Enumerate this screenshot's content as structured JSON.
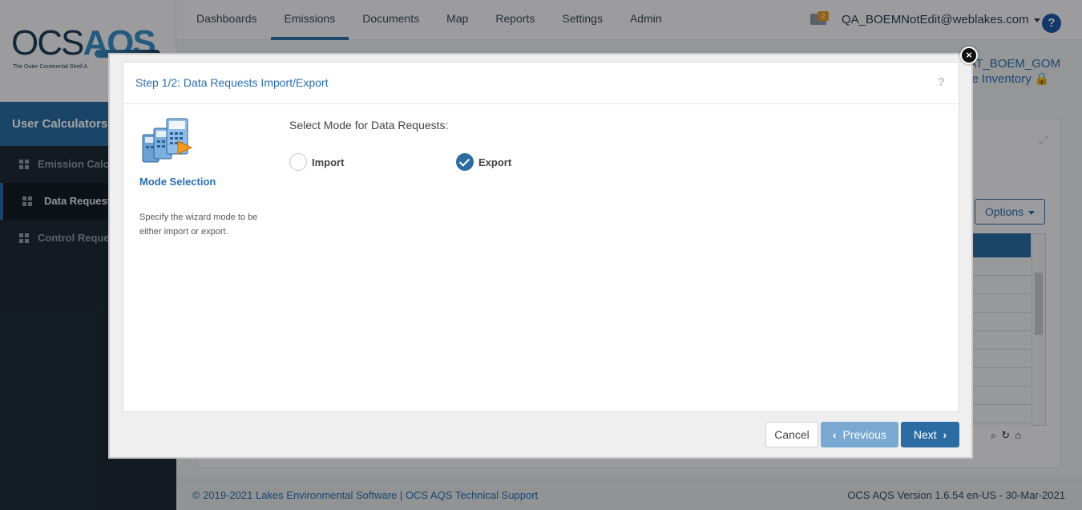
{
  "app": {
    "logo_text_left": "OCS",
    "logo_text_right": "AQS",
    "logo_tagline": "The Outer Continental Shelf A"
  },
  "nav": {
    "items": [
      {
        "label": "Dashboards"
      },
      {
        "label": "Emissions"
      },
      {
        "label": "Documents"
      },
      {
        "label": "Map"
      },
      {
        "label": "Reports"
      },
      {
        "label": "Settings"
      },
      {
        "label": "Admin"
      }
    ],
    "active": "Emissions"
  },
  "header": {
    "notification_count": "2",
    "user_email": "QA_BOEMNotEdit@weblakes.com",
    "help_label": "?"
  },
  "context": {
    "line1": "FAT_BOEM_GOM",
    "line2": "ete Inventory"
  },
  "sidebar": {
    "title": "User Calculators",
    "items": [
      {
        "label": "Emission Calcu"
      },
      {
        "label": "Data Request"
      },
      {
        "label": "Control Reque"
      }
    ]
  },
  "panel": {
    "options_label": "Options"
  },
  "footer": {
    "copyright": "© 2019-2021 Lakes Environmental Software",
    "separator": "|",
    "support_link": "OCS AQS Technical Support",
    "version": "OCS AQS Version 1.6.54 en-US - 30-Mar-2021"
  },
  "modal": {
    "close_label": "×",
    "title": "Step 1/2: Data Requests Import/Export",
    "help_label": "?",
    "step_name": "Mode Selection",
    "step_description": "Specify the wizard mode to be either import or export.",
    "prompt": "Select Mode for Data Requests:",
    "options": [
      {
        "label": "Import",
        "selected": false
      },
      {
        "label": "Export",
        "selected": true
      }
    ],
    "buttons": {
      "cancel": "Cancel",
      "previous": "Previous",
      "next": "Next"
    }
  },
  "colors": {
    "accent": "#2b6ca3",
    "sidebar_bg": "#1e2a36",
    "link": "#2a6fb0"
  }
}
